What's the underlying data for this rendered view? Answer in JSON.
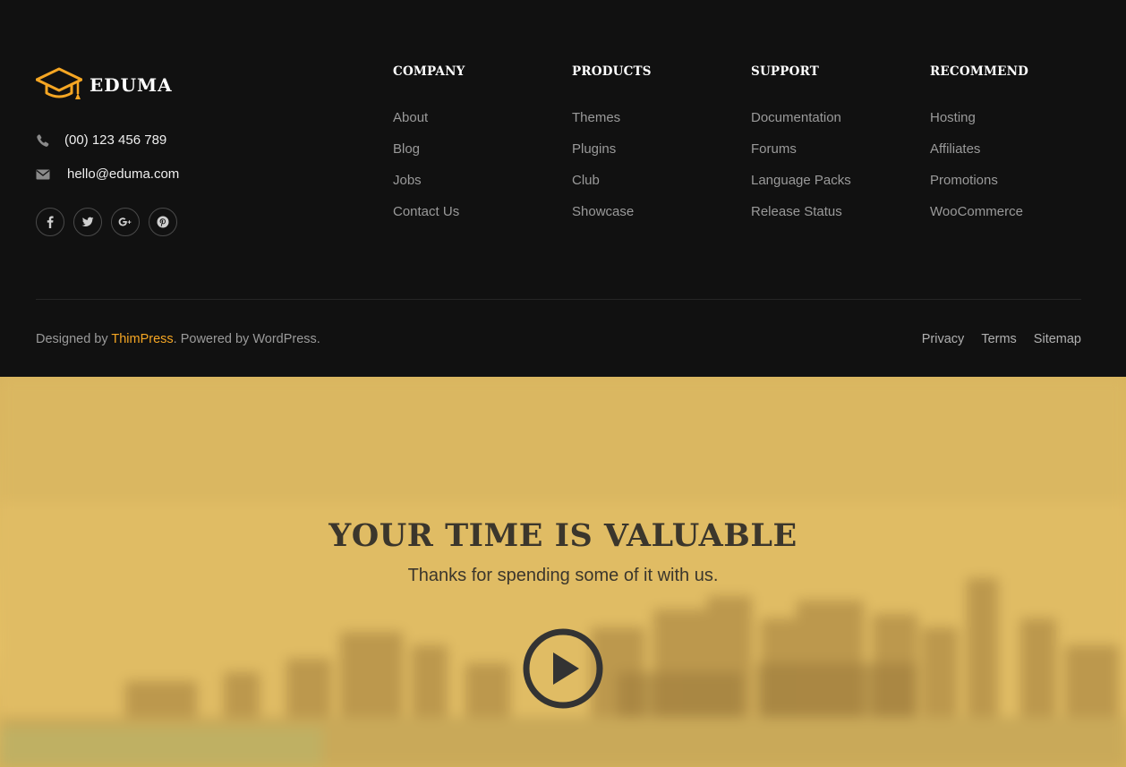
{
  "brand": {
    "name": "EDUMA",
    "accent_color": "#f5a623",
    "logo_icon": "graduation-cap-icon"
  },
  "contact": {
    "phone": "(00) 123 456 789",
    "email": "hello@eduma.com"
  },
  "socials": [
    {
      "icon": "facebook-icon"
    },
    {
      "icon": "twitter-icon"
    },
    {
      "icon": "google-plus-icon"
    },
    {
      "icon": "pinterest-icon"
    }
  ],
  "columns": {
    "company": {
      "title": "COMPANY",
      "links": [
        "About",
        "Blog",
        "Jobs",
        "Contact Us"
      ]
    },
    "products": {
      "title": "PRODUCTS",
      "links": [
        "Themes",
        "Plugins",
        "Club",
        "Showcase"
      ]
    },
    "support": {
      "title": "SUPPORT",
      "links": [
        "Documentation",
        "Forums",
        "Language Packs",
        "Release Status"
      ]
    },
    "recommend": {
      "title": "RECOMMEND",
      "links": [
        "Hosting",
        "Affiliates",
        "Promotions",
        "WooCommerce"
      ]
    }
  },
  "credits": {
    "prefix": "Designed by ",
    "author": "ThimPress",
    "suffix": ". Powered by WordPress."
  },
  "legal": {
    "privacy": "Privacy",
    "terms": "Terms",
    "sitemap": "Sitemap"
  },
  "hero": {
    "title": "YOUR TIME IS VALUABLE",
    "subtitle": "Thanks for spending some of it with us.",
    "play_icon": "play-icon"
  },
  "colors": {
    "footer_bg": "#111111",
    "hero_bg": "#e0bc64",
    "hero_text": "#3b362c",
    "link_text": "#9a9a9a"
  }
}
